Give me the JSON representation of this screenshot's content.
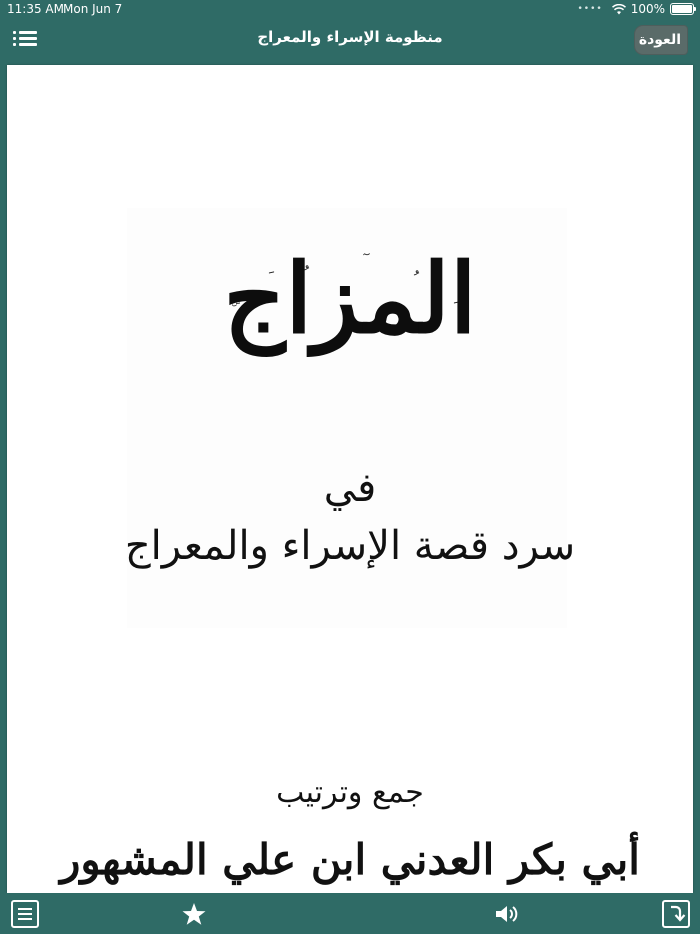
{
  "status": {
    "time": "11:35 AM",
    "date": "Mon Jun 7",
    "battery": "100%"
  },
  "nav": {
    "title": "منظومة الإسراء والمعراج",
    "back_label": "العودة"
  },
  "cover": {
    "title": "المزاج",
    "title_line": "المزاج",
    "preposition": "في",
    "subtitle": "سرد قصة الإسراء والمعراج",
    "compiled_by": "جمع وترتيب",
    "author": "أبي بكر العدني ابن علي المشهور"
  },
  "toolbar": {
    "icons": [
      "list-icon",
      "star-icon",
      "speaker-icon",
      "forward-icon"
    ]
  },
  "colors": {
    "bar": "#2f6b66",
    "page": "#ffffff"
  }
}
